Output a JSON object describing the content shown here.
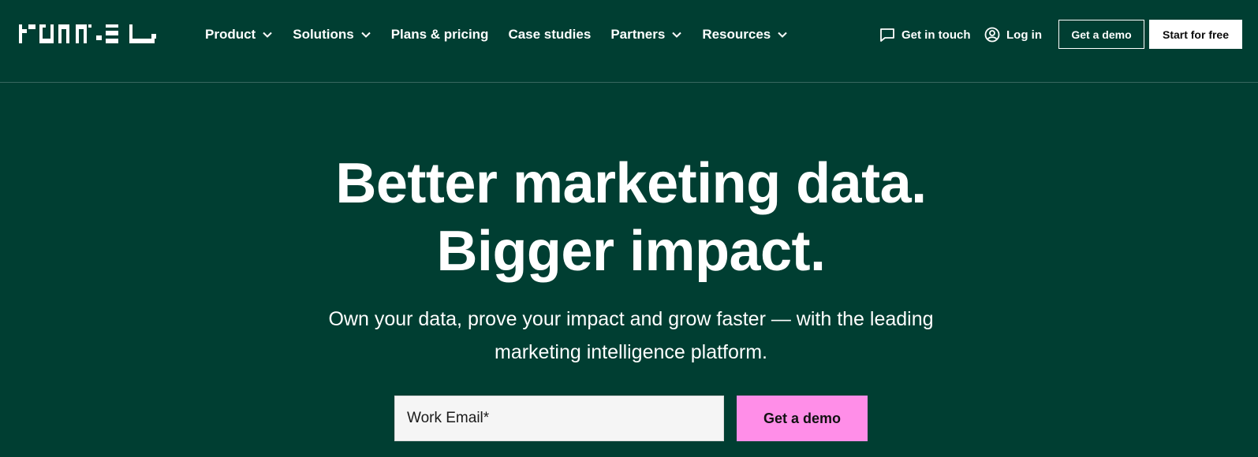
{
  "brand": {
    "name": "Funnel"
  },
  "nav": {
    "items": [
      {
        "label": "Product",
        "has_dropdown": true
      },
      {
        "label": "Solutions",
        "has_dropdown": true
      },
      {
        "label": "Plans & pricing",
        "has_dropdown": false
      },
      {
        "label": "Case studies",
        "has_dropdown": false
      },
      {
        "label": "Partners",
        "has_dropdown": true
      },
      {
        "label": "Resources",
        "has_dropdown": true
      }
    ]
  },
  "header_actions": {
    "contact_label": "Get in touch",
    "contact_icon": "chat-bubble-icon",
    "login_label": "Log in",
    "login_icon": "user-circle-icon",
    "demo_label": "Get a demo",
    "start_label": "Start for free"
  },
  "hero": {
    "title_lines": [
      "Better marketing data.",
      "Bigger impact."
    ],
    "subtitle_lines": [
      "Own your data, prove your impact and grow faster — with the leading",
      "marketing intelligence platform."
    ],
    "email_placeholder": "Work Email*",
    "cta_label": "Get a demo"
  },
  "colors": {
    "background": "#003e32",
    "text": "#ffffff",
    "cta": "#ff8ee8",
    "input_bg": "#f5f5f5"
  }
}
